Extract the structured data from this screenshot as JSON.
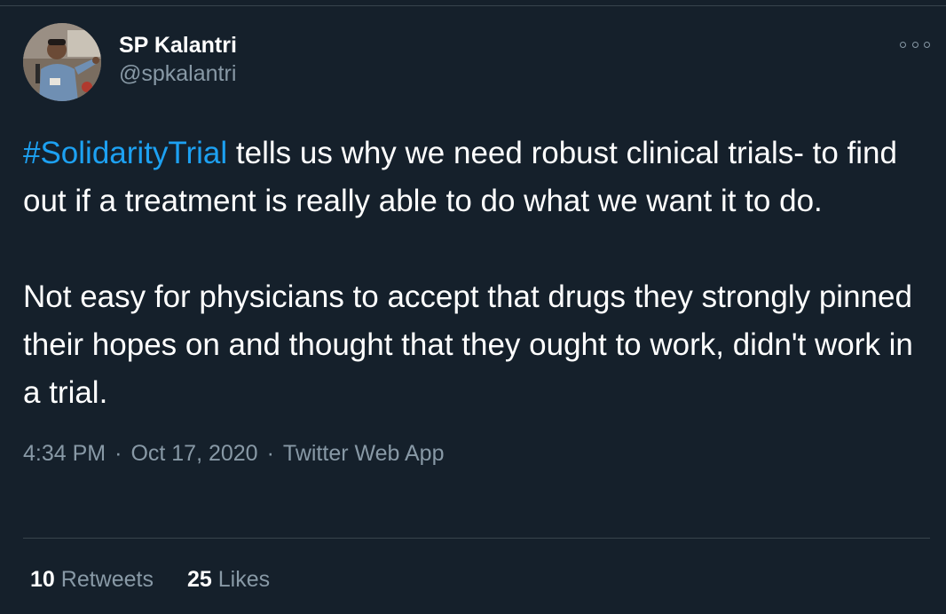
{
  "tweet": {
    "author": {
      "display_name": "SP Kalantri",
      "handle": "@spkalantri",
      "avatar_icon": "profile-photo"
    },
    "more_icon": "ellipsis-icon",
    "text": {
      "hashtag": "#SolidarityTrial",
      "paragraph1_rest": " tells us why we need robust clinical trials- to find out if a treatment is really able to do what we want it to do.",
      "paragraph2": "Not easy for physicians to accept that drugs they strongly pinned their hopes on and thought that they ought to work, didn't work in a trial."
    },
    "meta": {
      "time": "4:34 PM",
      "date": "Oct 17, 2020",
      "source": "Twitter Web App",
      "separator": "·"
    },
    "stats": {
      "retweets_count": "10",
      "retweets_label": "Retweets",
      "likes_count": "25",
      "likes_label": "Likes"
    }
  },
  "colors": {
    "background": "#15202b",
    "text": "#ffffff",
    "secondary_text": "#8899a6",
    "link": "#1da1f2",
    "divider": "#38444d"
  }
}
